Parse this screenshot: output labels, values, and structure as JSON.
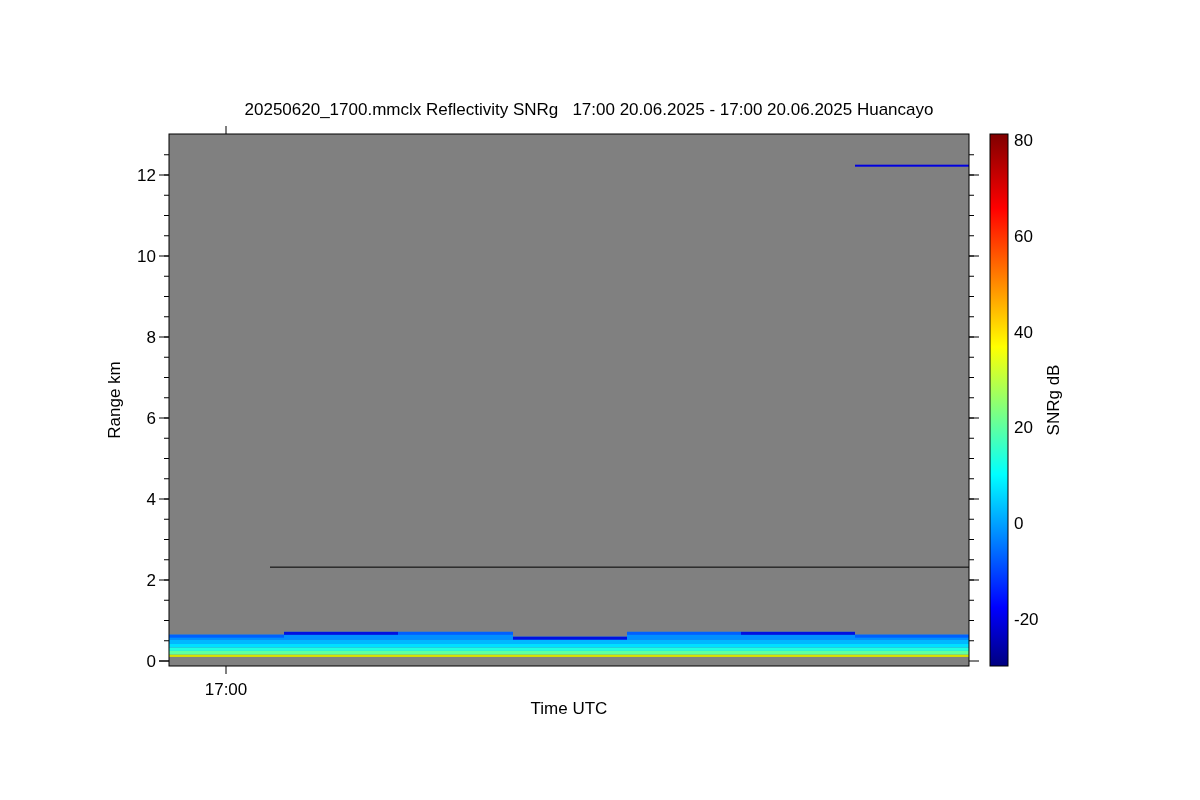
{
  "title": "20250620_1700.mmclx Reflectivity SNRg   17:00 20.06.2025 - 17:00 20.06.2025 Huancayo",
  "plot": {
    "ylabel": "Range km",
    "xlabel": "Time UTC",
    "yticks": [
      "12",
      "10",
      "8",
      "6",
      "4",
      "2",
      "0"
    ],
    "xticks": [
      "17:00"
    ]
  },
  "colorbar": {
    "label": "SNRg dB",
    "ticks": [
      "80",
      "60",
      "40",
      "20",
      "0",
      "-20"
    ]
  }
}
